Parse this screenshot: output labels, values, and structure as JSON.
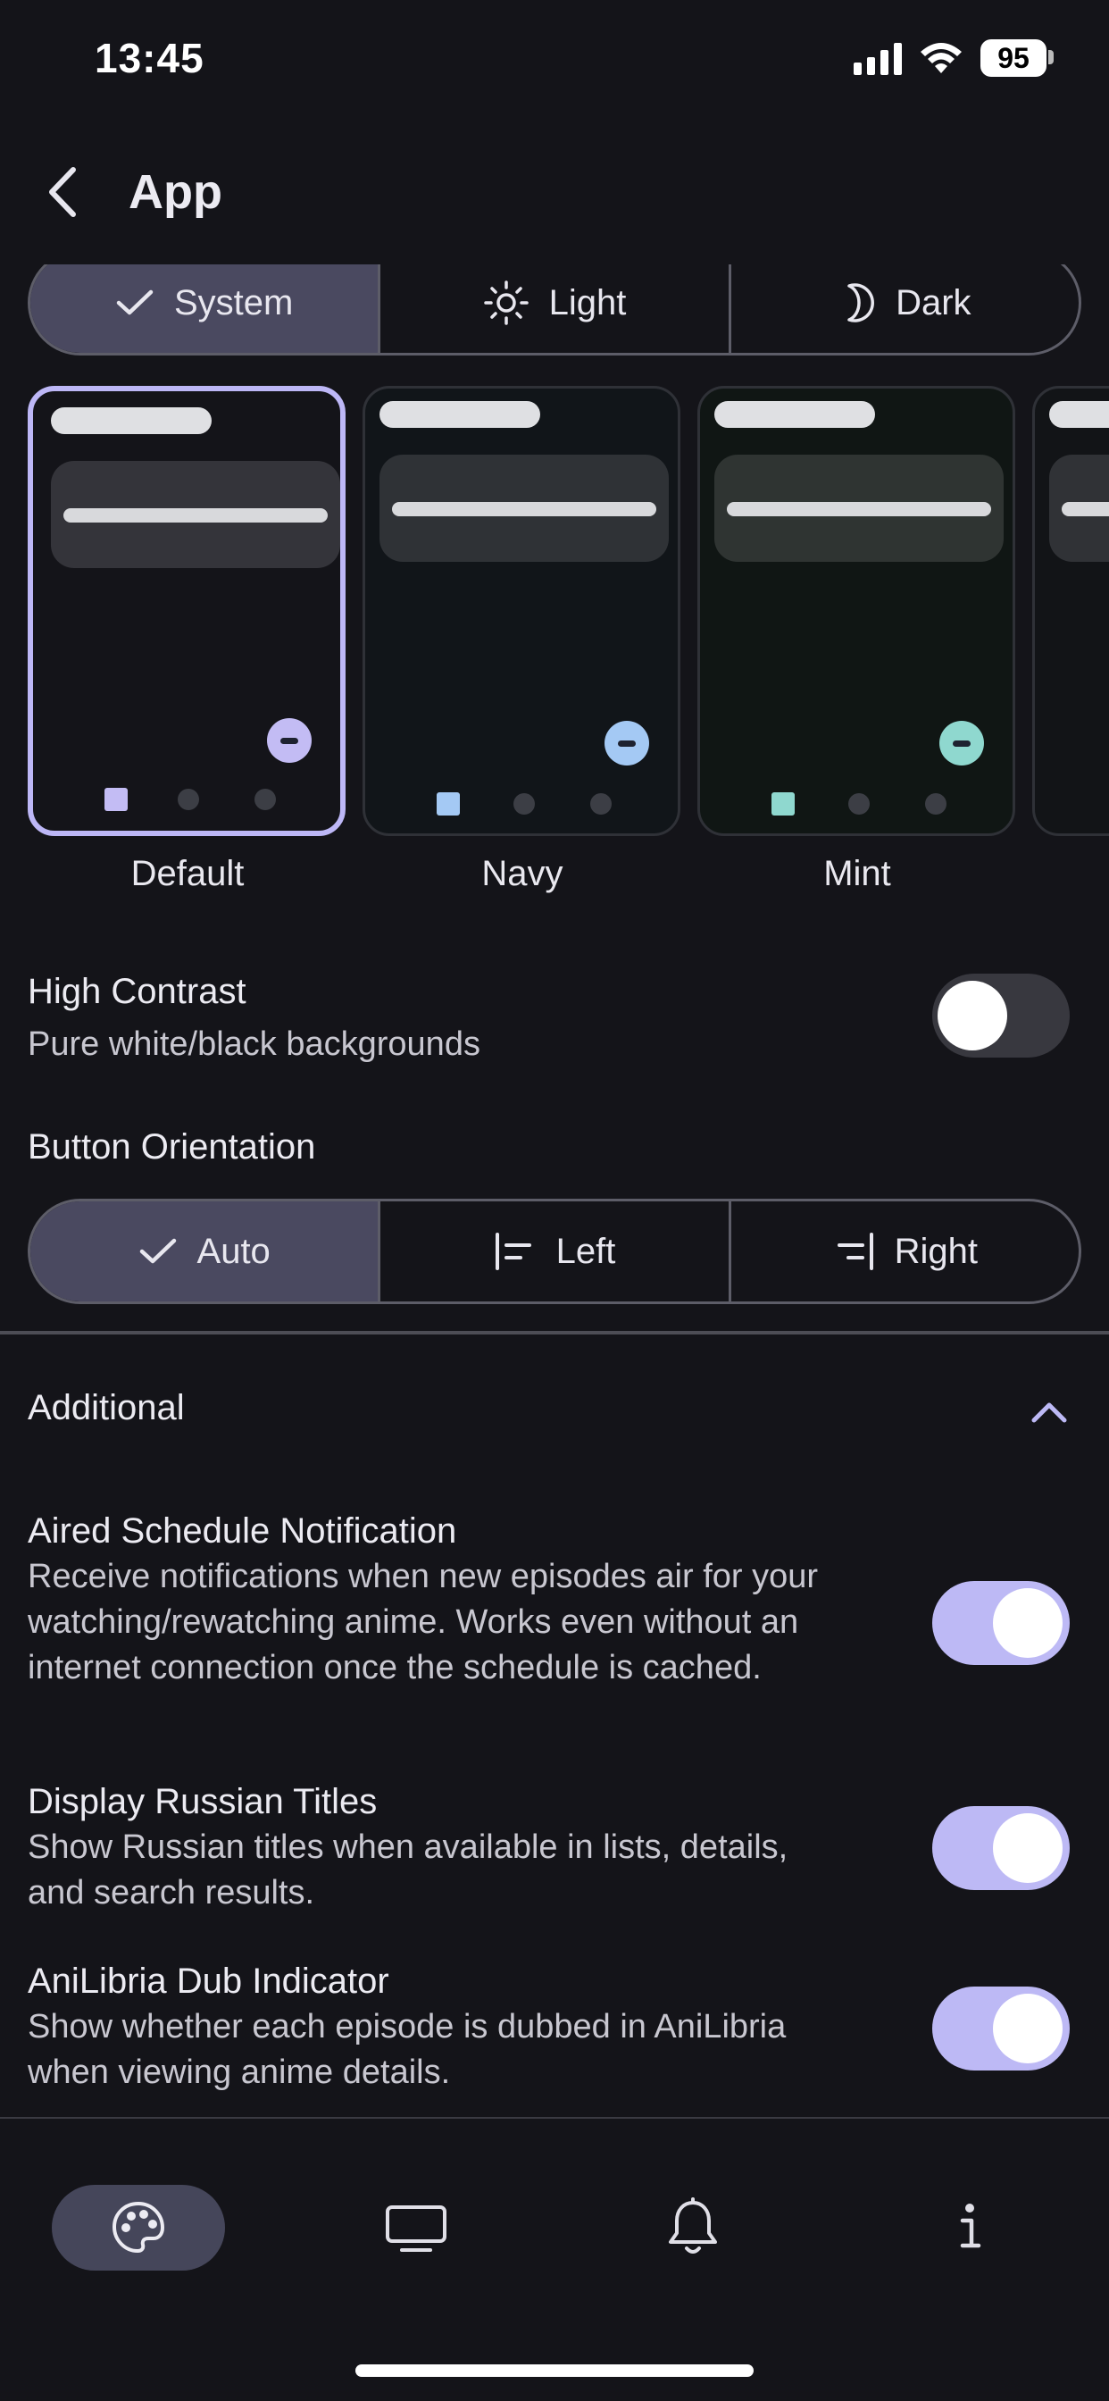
{
  "status_bar": {
    "time": "13:45",
    "battery": "95"
  },
  "header": {
    "title": "App"
  },
  "theme_mode": {
    "options": [
      {
        "label": "System",
        "icon": "check-icon",
        "selected": true
      },
      {
        "label": "Light",
        "icon": "sun-icon",
        "selected": false
      },
      {
        "label": "Dark",
        "icon": "moon-icon",
        "selected": false
      }
    ]
  },
  "palettes": [
    {
      "label": "Default",
      "selected": true,
      "bg": "#141419",
      "accent": "#c3bcf4"
    },
    {
      "label": "Navy",
      "selected": false,
      "bg": "#111519",
      "accent": "#a4c9f4"
    },
    {
      "label": "Mint",
      "selected": false,
      "bg": "#101614",
      "accent": "#8fd8cf"
    }
  ],
  "high_contrast": {
    "title": "High Contrast",
    "subtitle": "Pure white/black backgrounds",
    "enabled": false
  },
  "button_orientation": {
    "title": "Button Orientation",
    "options": [
      {
        "label": "Auto",
        "icon": "check-icon",
        "selected": true
      },
      {
        "label": "Left",
        "icon": "align-left-icon",
        "selected": false
      },
      {
        "label": "Right",
        "icon": "align-right-icon",
        "selected": false
      }
    ]
  },
  "additional": {
    "title": "Additional",
    "items": [
      {
        "title": "Aired Schedule Notification",
        "subtitle": "Receive notifications when new episodes air for your watching/rewatching anime. Works even without an internet connection once the schedule is cached.",
        "enabled": true
      },
      {
        "title": "Display Russian Titles",
        "subtitle": "Show Russian titles when available in lists, details, and search results.",
        "enabled": true
      },
      {
        "title": "AniLibria Dub Indicator",
        "subtitle": "Show whether each episode is dubbed in AniLibria when viewing anime details.",
        "enabled": true
      }
    ]
  },
  "bottom_nav": {
    "items": [
      {
        "icon": "palette-icon",
        "selected": true
      },
      {
        "icon": "monitor-icon",
        "selected": false
      },
      {
        "icon": "bell-icon",
        "selected": false
      },
      {
        "icon": "info-icon",
        "selected": false
      }
    ]
  },
  "colors": {
    "accent": "#bdb9f5",
    "background": "#141419",
    "segment_selected": "#4a4960"
  }
}
